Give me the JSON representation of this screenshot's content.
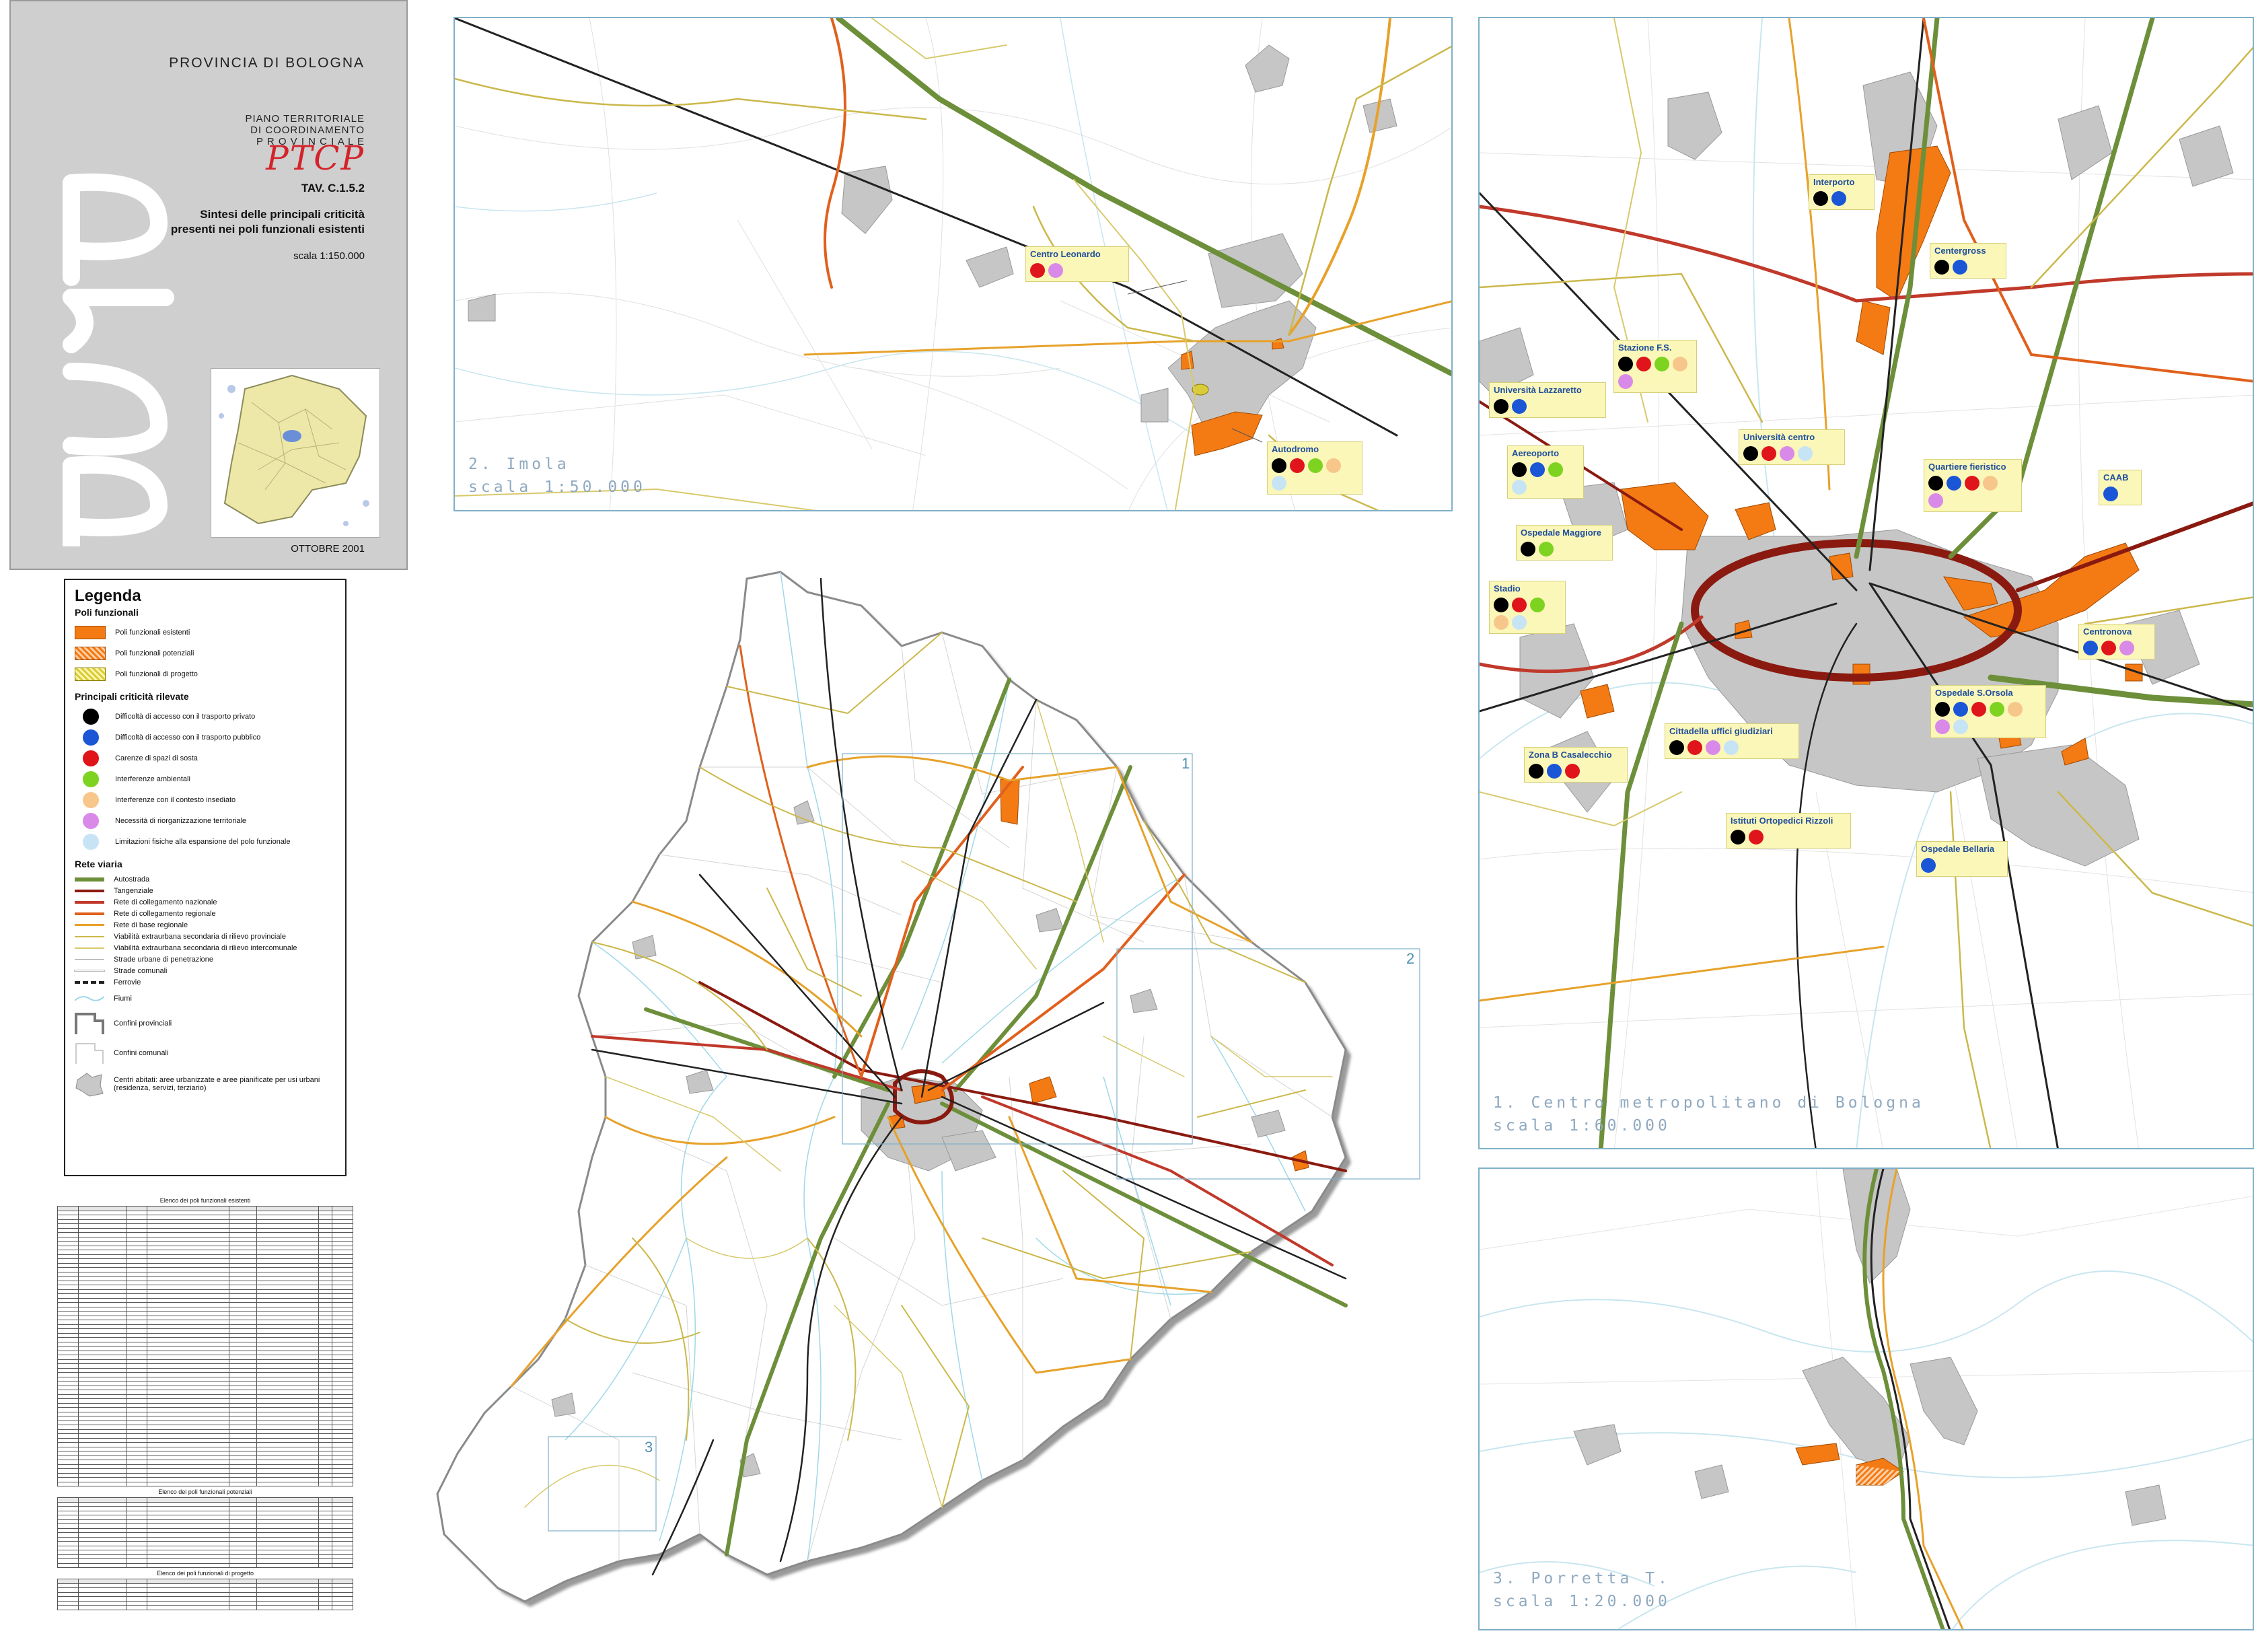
{
  "colors": {
    "black": "#000000",
    "blue": "#1a56d6",
    "red": "#e0141b",
    "green": "#7ed321",
    "peach": "#f7c68a",
    "violet": "#d98ae8",
    "lightblue": "#c7e4f5",
    "poli_esistenti": "#f47a14",
    "autostrada": "#6d8f3a",
    "tangenziale": "#8a1a10",
    "nazionale": "#c0392b",
    "regionale": "#e0601c",
    "base_regionale": "#e7a12a",
    "provinciale": "#cbb84a",
    "intercomunale": "#d8c96b",
    "fiumi": "#9fd8e8",
    "urban": "#c8c8c8"
  },
  "title_block": {
    "province": "PROVINCIA DI BOLOGNA",
    "plan_line1": "PIANO TERRITORIALE",
    "plan_line2": "DI COORDINAMENTO",
    "plan_line3": "P R O V I N C I A L E",
    "logo": "PTCP",
    "tav": "TAV. C.1.5.2",
    "subtitle1": "Sintesi delle principali criticità",
    "subtitle2": "presenti nei poli funzionali esistenti",
    "scale": "scala 1:150.000",
    "date": "OTTOBRE 2001"
  },
  "legend": {
    "title": "Legenda",
    "section_poli": "Poli funzionali",
    "poli": [
      {
        "label": "Poli funzionali esistenti",
        "style": "solid-orange"
      },
      {
        "label": "Poli funzionali potenziali",
        "style": "hatch-orange"
      },
      {
        "label": "Poli funzionali di progetto",
        "style": "hatch-yellow"
      }
    ],
    "section_criticita": "Principali criticità rilevate",
    "criticita": [
      {
        "label": "Difficoltà di accesso con il trasporto privato",
        "color": "black"
      },
      {
        "label": "Difficoltà di accesso con il trasporto pubblico",
        "color": "blue"
      },
      {
        "label": "Carenze di spazi di sosta",
        "color": "red"
      },
      {
        "label": "Interferenze ambientali",
        "color": "green"
      },
      {
        "label": "Interferenze con il contesto insediato",
        "color": "peach"
      },
      {
        "label": "Necessità di riorganizzazione territoriale",
        "color": "violet"
      },
      {
        "label": "Limitazioni fisiche alla espansione del polo funzionale",
        "color": "lightblue"
      }
    ],
    "section_rete": "Rete viaria",
    "rete": [
      {
        "label": "Autostrada",
        "color": "#6d8f3a",
        "w": 6
      },
      {
        "label": "Tangenziale",
        "color": "#8a1a10",
        "w": 4
      },
      {
        "label": "Rete di collegamento nazionale",
        "color": "#c0392b",
        "w": 4
      },
      {
        "label": "Rete di collegamento regionale",
        "color": "#e0601c",
        "w": 4
      },
      {
        "label": "Rete di base regionale",
        "color": "#e7a12a",
        "w": 3
      },
      {
        "label": "Viabilità extraurbana secondaria di rilievo provinciale",
        "color": "#cbb84a",
        "w": 2
      },
      {
        "label": "Viabilità extraurbana secondaria di rilievo intercomunale",
        "color": "#d8c96b",
        "w": 2
      },
      {
        "label": "Strade urbane di penetrazione",
        "color": "#999999",
        "w": 1
      },
      {
        "label": "Strade comunali",
        "color": "#ffffff",
        "w": 1
      }
    ],
    "ferrovie": "Ferrovie",
    "fiumi": "Fiumi",
    "confini_prov": "Confini provinciali",
    "confini_com": "Confini comunali",
    "centri": "Centri abitati: aree urbanizzate e aree pianificate per usi urbani (residenza, servizi, terziario)"
  },
  "tables": {
    "t1_title": "Elenco dei poli funzionali esistenti",
    "t2_title": "Elenco dei poli funzionali potenziali",
    "t3_title": "Elenco dei poli funzionali di progetto"
  },
  "maps": {
    "imola": {
      "caption": "2. Imola\nscala 1:50.000"
    },
    "bologna": {
      "caption": "1. Centro metropolitano di Bologna\nscala 1:60.000"
    },
    "porretta": {
      "caption": "3. Porretta T.\nscala 1:20.000"
    },
    "main": {
      "inset_labels": [
        "1",
        "2",
        "3"
      ]
    }
  },
  "callouts": [
    {
      "id": "centro-leonardo",
      "name": "Centro Leonardo",
      "dots": [
        "red",
        "violet"
      ]
    },
    {
      "id": "autodromo",
      "name": "Autodromo",
      "dots": [
        "black",
        "red",
        "green",
        "peach",
        "lightblue"
      ]
    },
    {
      "id": "interporto",
      "name": "Interporto",
      "dots": [
        "black",
        "blue"
      ]
    },
    {
      "id": "centergross",
      "name": "Centergross",
      "dots": [
        "black",
        "blue"
      ]
    },
    {
      "id": "stazione-fs",
      "name": "Stazione F.S.",
      "dots": [
        "black",
        "red",
        "green",
        "peach",
        "violet"
      ]
    },
    {
      "id": "universita-lazzaretto",
      "name": "Università  Lazzaretto",
      "dots": [
        "black",
        "blue"
      ]
    },
    {
      "id": "universita-centro",
      "name": "Università centro",
      "dots": [
        "black",
        "red",
        "violet",
        "lightblue"
      ]
    },
    {
      "id": "aeroporto",
      "name": "Aereoporto",
      "dots": [
        "black",
        "blue",
        "green",
        "lightblue"
      ]
    },
    {
      "id": "quartiere-fieristico",
      "name": "Quartiere fieristico",
      "dots": [
        "black",
        "blue",
        "red",
        "peach",
        "violet"
      ]
    },
    {
      "id": "caab",
      "name": "CAAB",
      "dots": [
        "blue"
      ]
    },
    {
      "id": "ospedale-maggiore",
      "name": "Ospedale Maggiore",
      "dots": [
        "black",
        "green"
      ]
    },
    {
      "id": "stadio",
      "name": "Stadio",
      "dots": [
        "black",
        "red",
        "green",
        "peach",
        "lightblue"
      ]
    },
    {
      "id": "centronova",
      "name": "Centronova",
      "dots": [
        "blue",
        "red",
        "violet"
      ]
    },
    {
      "id": "ospedale-sorsola",
      "name": "Ospedale S.Orsola",
      "dots": [
        "black",
        "blue",
        "red",
        "green",
        "peach",
        "violet",
        "lightblue"
      ]
    },
    {
      "id": "cittadella",
      "name": "Cittadella uffici giudiziari",
      "dots": [
        "black",
        "red",
        "violet",
        "lightblue"
      ]
    },
    {
      "id": "zona-casalecchio",
      "name": "Zona B Casalecchio",
      "dots": [
        "black",
        "blue",
        "red"
      ]
    },
    {
      "id": "istituti-rizzoli",
      "name": "Istituti Ortopedici Rizzoli",
      "dots": [
        "black",
        "red"
      ]
    },
    {
      "id": "ospedale-bellaria",
      "name": "Ospedale Bellaria",
      "dots": [
        "blue"
      ]
    }
  ]
}
